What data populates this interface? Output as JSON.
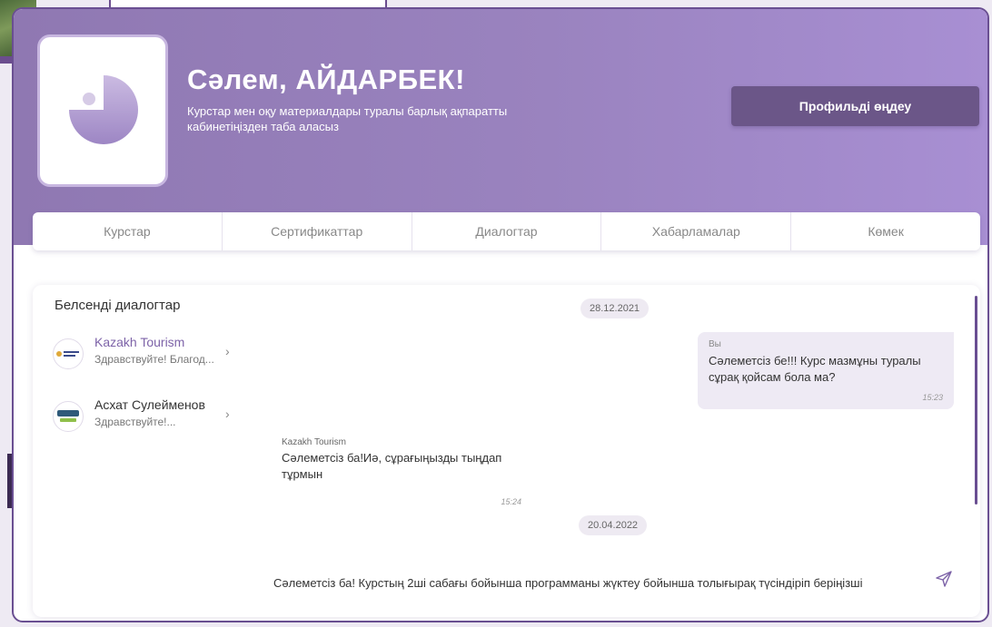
{
  "header": {
    "greeting": "Сәлем, АЙДАРБЕК!",
    "subtitle": "Курстар мен оқу материалдары туралы барлық ақпаратты кабинетіңізден таба аласыз",
    "edit_profile_label": "Профильді өңдеу"
  },
  "tabs": [
    {
      "label": "Курстар"
    },
    {
      "label": "Сертификаттар"
    },
    {
      "label": "Диалогтар"
    },
    {
      "label": "Хабарламалар"
    },
    {
      "label": "Көмек"
    }
  ],
  "dialogs": {
    "title": "Белсенді диалогтар",
    "items": [
      {
        "name": "Kazakh Tourism",
        "preview": "Здравствуйте! Благод...",
        "logo": "kazakh-tourism-logo"
      },
      {
        "name": "Асхат Сулейменов",
        "preview": "Здравствуйте!...",
        "logo": "cseed-logo"
      }
    ]
  },
  "chat": {
    "date1": "28.12.2021",
    "date2": "20.04.2022",
    "outgoing": {
      "sender": "Вы",
      "text": "Сәлеметсіз бе!!! Курс мазмұны туралы сұрақ қойсам бола ма?",
      "time": "15:23"
    },
    "incoming": {
      "sender": "Kazakh Tourism",
      "text": "Сәлеметсіз ба!Иә, сұрағыңызды тыңдап тұрмын",
      "time": "15:24"
    },
    "compose_value": "Сәлеметсіз ба! Курстың 2ші сабағы бойынша программаны жүктеу бойынша толығырақ түсіндіріп беріңізші",
    "send_icon": "send-icon"
  },
  "colors": {
    "banner_start": "#8f78b2",
    "banner_end": "#a88fd3",
    "button": "#6b5688",
    "accent": "#7d63a8"
  }
}
